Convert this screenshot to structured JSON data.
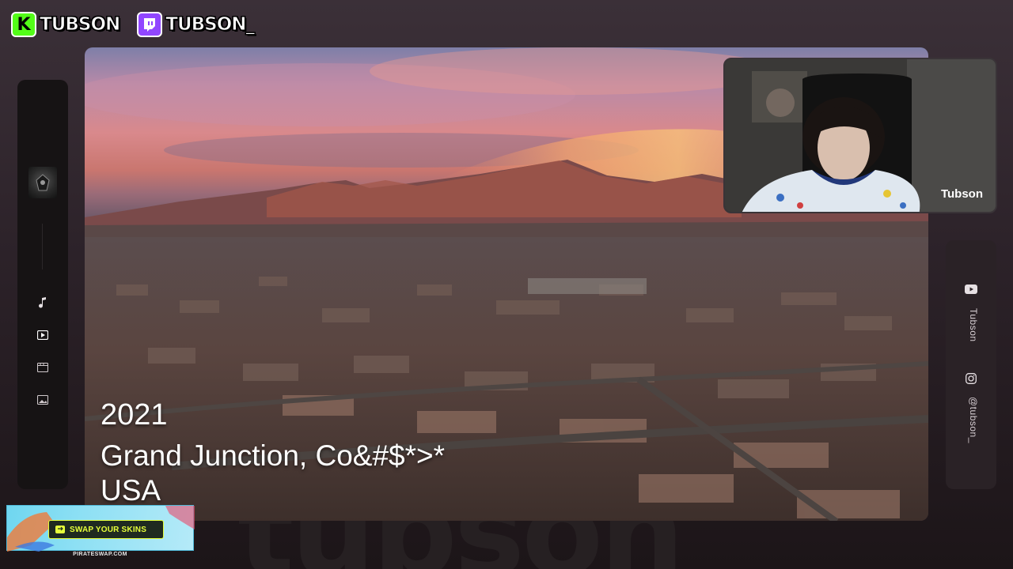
{
  "branding": {
    "kick_name": "TUBSON",
    "twitch_name": "TUBSON_"
  },
  "watermark": "tubson",
  "left_rail": {
    "avatar": "channel-avatar",
    "icons": [
      "music-note-icon",
      "play-icon",
      "film-icon",
      "image-icon"
    ]
  },
  "video": {
    "caption_year": "2021",
    "caption_city": "Grand Junction, Co&#$*>*",
    "caption_country": "USA"
  },
  "webcam": {
    "streamer_name": "Tubson"
  },
  "right_rail": {
    "youtube_label": "Tubson",
    "instagram_label": "@tubson_"
  },
  "ad": {
    "button_label": "SWAP YOUR SKINS",
    "url": "PIRATESWAP.COM"
  },
  "colors": {
    "kick": "#53fc18",
    "twitch": "#9146ff",
    "ad_accent": "#e6ff3a"
  }
}
